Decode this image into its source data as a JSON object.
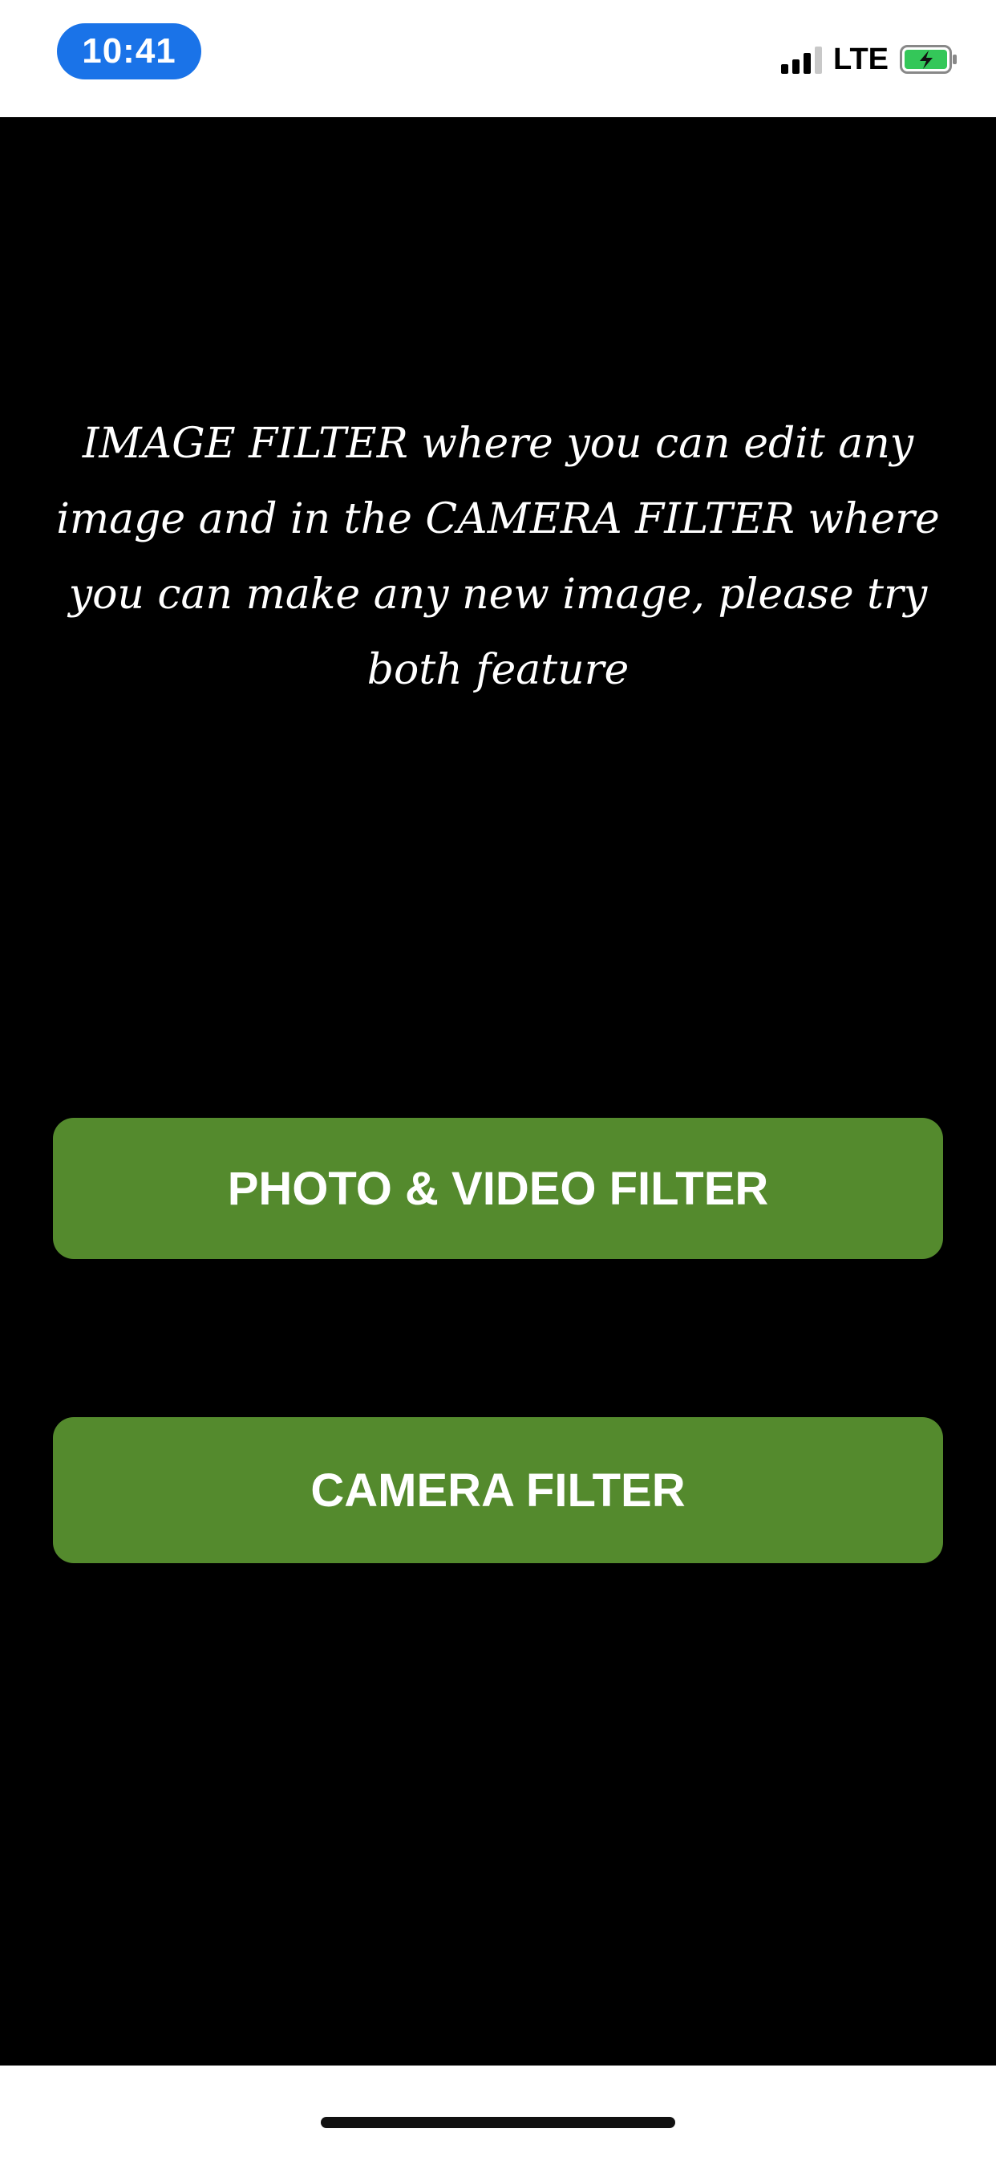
{
  "status_bar": {
    "time": "10:41",
    "network": "LTE",
    "colors": {
      "time_pill": "#1a73e8",
      "battery_fill": "#34c759"
    },
    "icons": [
      "signal-icon",
      "battery-charging-icon"
    ]
  },
  "main": {
    "description": "IMAGE FILTER where you can edit any image and in the CAMERA FILTER where you can make any new image, please try both feature",
    "buttons": {
      "photo_video": "PHOTO & VIDEO FILTER",
      "camera": "CAMERA FILTER"
    },
    "colors": {
      "background": "#000000",
      "button": "#548a2d",
      "button_text": "#ffffff"
    }
  }
}
